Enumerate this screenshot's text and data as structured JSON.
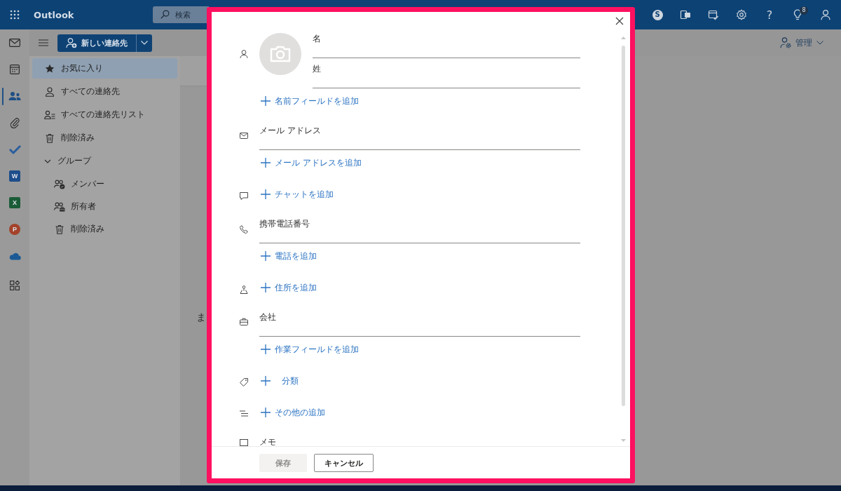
{
  "app_bar": {
    "app_name": "Outlook",
    "search": {
      "placeholder": "検索"
    },
    "actions": [
      {
        "kind": "skype",
        "glyph": "S"
      },
      {
        "kind": "office"
      },
      {
        "kind": "my_day"
      },
      {
        "kind": "settings"
      },
      {
        "kind": "help",
        "glyph": "?"
      },
      {
        "kind": "tips",
        "badge": "8"
      },
      {
        "kind": "account"
      }
    ]
  },
  "nav_rail": [
    {
      "kind": "mail",
      "selected": false
    },
    {
      "kind": "calendar",
      "selected": false
    },
    {
      "kind": "people",
      "selected": true
    },
    {
      "kind": "files",
      "selected": false
    },
    {
      "kind": "todo",
      "selected": false
    },
    {
      "kind": "word",
      "letter": "W",
      "selected": false
    },
    {
      "kind": "excel",
      "letter": "X",
      "selected": false
    },
    {
      "kind": "powerpoint",
      "letter": "P",
      "selected": false
    },
    {
      "kind": "onedrive",
      "selected": false
    },
    {
      "kind": "apps",
      "selected": false
    }
  ],
  "command_bar": {
    "new_contact_button": "新しい連絡先",
    "manage_button": "管理"
  },
  "folders": [
    {
      "kind": "favorites",
      "label": "お気に入り",
      "selected": true
    },
    {
      "kind": "all_contacts",
      "label": "すべての連絡先",
      "selected": false
    },
    {
      "kind": "all_lists",
      "label": "すべての連絡先リスト",
      "selected": false
    },
    {
      "kind": "deleted",
      "label": "削除済み",
      "selected": false
    },
    {
      "kind": "group",
      "label": "グループ",
      "selected": false,
      "expanded": true,
      "children": [
        {
          "kind": "member",
          "label": "メンバー",
          "selected": false
        },
        {
          "kind": "owner",
          "label": "所有者",
          "selected": false
        },
        {
          "kind": "deleted",
          "label": "削除済み",
          "selected": false
        }
      ]
    }
  ],
  "contact_list": {
    "message": "ま"
  },
  "dialog": {
    "sections": [
      {
        "kind": "name",
        "fields": [
          {
            "label": "名"
          },
          {
            "label": "姓"
          }
        ],
        "add_link": "名前フィールドを追加"
      },
      {
        "kind": "email",
        "fields": [
          {
            "label": "メール アドレス"
          }
        ],
        "add_link": "メール アドレスを追加"
      },
      {
        "kind": "chat",
        "add_link": "チャットを追加"
      },
      {
        "kind": "phone",
        "fields": [
          {
            "label": "携帯電話番号"
          }
        ],
        "add_link": "電話を追加"
      },
      {
        "kind": "address",
        "add_link": "住所を追加"
      },
      {
        "kind": "work",
        "fields": [
          {
            "label": "会社"
          }
        ],
        "add_link": "作業フィールドを追加"
      },
      {
        "kind": "category",
        "add_link": "分類"
      },
      {
        "kind": "more",
        "add_link": "その他の追加"
      },
      {
        "kind": "notes",
        "fields": [
          {
            "label": "メモ"
          }
        ]
      }
    ],
    "buttons": [
      {
        "label": "保存",
        "disabled": true
      },
      {
        "label": "キャンセル",
        "disabled": false
      }
    ]
  }
}
